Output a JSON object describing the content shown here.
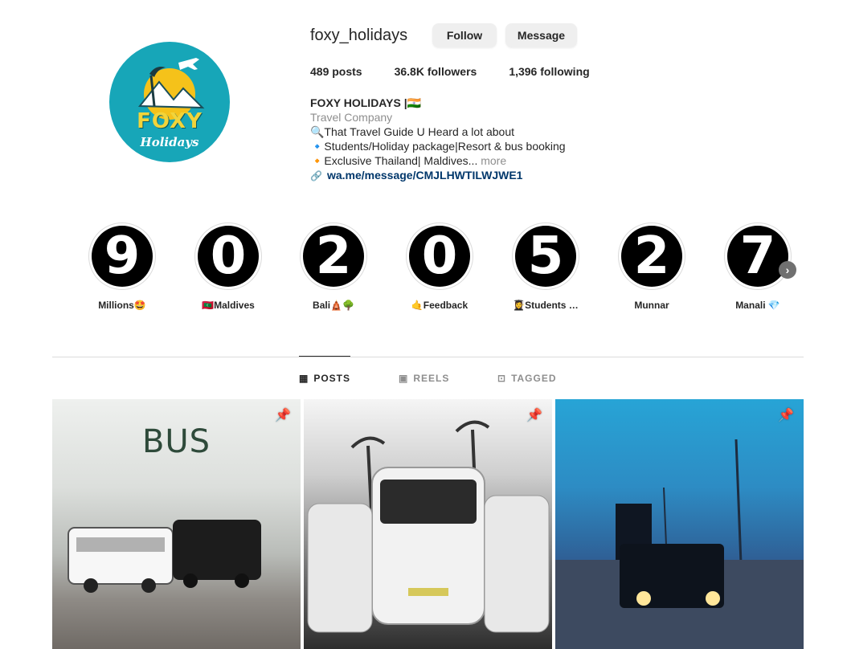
{
  "profile": {
    "username": "foxy_holidays",
    "follow_label": "Follow",
    "message_label": "Message",
    "avatar_brand": "FOXY",
    "avatar_sub": "Holidays"
  },
  "stats": {
    "posts_count": "489",
    "posts_label": "posts",
    "followers_count": "36.8K",
    "followers_label": "followers",
    "following_count": "1,396",
    "following_label": "following"
  },
  "bio": {
    "name": "FOXY HOLIDAYS |🇮🇳",
    "category": "Travel Company",
    "line1": "🔍That Travel Guide U Heard a lot about",
    "line2": "🔹Students/Holiday package|Resort & bus booking",
    "line3": "🔸Exclusive Thailand| Maldives...",
    "more": "more",
    "link": "wa.me/message/CMJLHWTILWJWE1"
  },
  "highlights": [
    {
      "digit": "9",
      "label": "Millions🤩"
    },
    {
      "digit": "0",
      "label": "🇲🇻Maldives"
    },
    {
      "digit": "2",
      "label": "Bali🛕🌳"
    },
    {
      "digit": "0",
      "label": "🤙Feedback"
    },
    {
      "digit": "5",
      "label": "👩‍🎓Students …"
    },
    {
      "digit": "2",
      "label": "Munnar"
    },
    {
      "digit": "7",
      "label": "Manali 💎"
    }
  ],
  "tabs": {
    "posts": "POSTS",
    "reels": "REELS",
    "tagged": "TAGGED"
  },
  "posts": [
    {
      "overlay_text": "BUS"
    },
    {},
    {}
  ],
  "colors": {
    "avatar_bg": "#17a6b8",
    "link": "#00376b",
    "button_bg": "#efefef"
  },
  "icons": [
    "pin-icon",
    "grid-icon",
    "reels-icon",
    "tagged-icon",
    "link-icon",
    "chevron-right-icon"
  ]
}
